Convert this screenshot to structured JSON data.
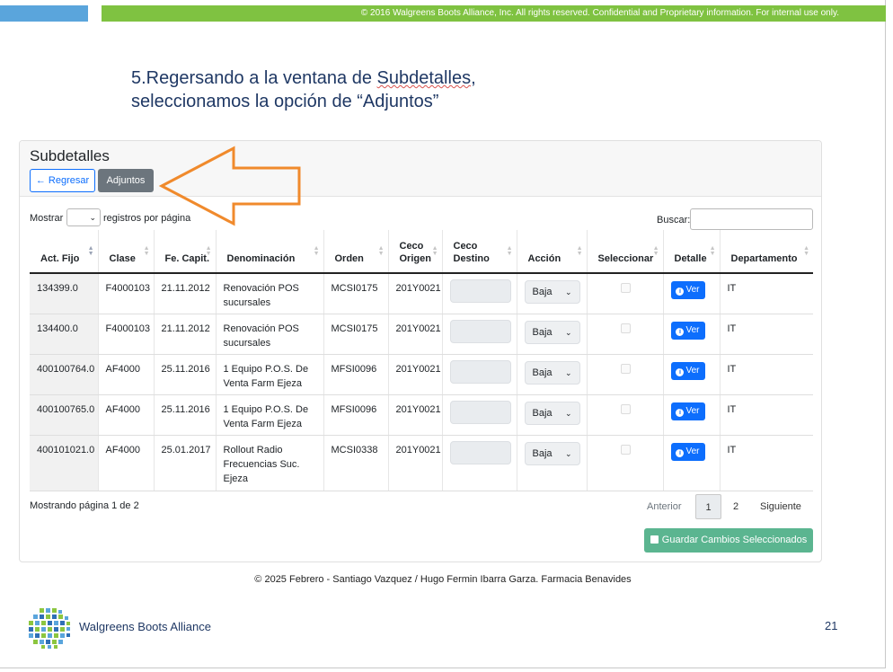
{
  "banner": {
    "copyright": "© 2016 Walgreens Boots Alliance, Inc. All rights reserved. Confidential and Proprietary information. For internal use only."
  },
  "instruction": {
    "line1_prefix": "5.Regersando a la ventana de ",
    "line1_word": "Subdetalles",
    "line1_suffix": ",",
    "line2": "seleccionamos la opción de “Adjuntos”"
  },
  "card": {
    "title": "Subdetalles",
    "back_label": "Regresar",
    "attach_label": "Adjuntos",
    "show_label": "Mostrar",
    "per_page_label": "registros por página",
    "search_label": "Buscar:",
    "columns": [
      "Act. Fijo",
      "Clase",
      "Fe. Capit.",
      "Denominación",
      "Orden",
      "Ceco Origen",
      "Ceco Destino",
      "Acción",
      "Seleccionar",
      "Detalle",
      "Departamento"
    ],
    "rows": [
      {
        "act": "134399.0",
        "clase": "F4000103",
        "fecha": "21.11.2012",
        "denom": "Renovación POS sucursales",
        "orden": "MCSI0175",
        "ceco_origen": "201Y0021",
        "accion": "Baja",
        "detalle": "Ver",
        "depto": "IT"
      },
      {
        "act": "134400.0",
        "clase": "F4000103",
        "fecha": "21.11.2012",
        "denom": "Renovación POS sucursales",
        "orden": "MCSI0175",
        "ceco_origen": "201Y0021",
        "accion": "Baja",
        "detalle": "Ver",
        "depto": "IT"
      },
      {
        "act": "400100764.0",
        "clase": "AF4000",
        "fecha": "25.11.2016",
        "denom": "1 Equipo P.O.S. De Venta Farm Ejeza",
        "orden": "MFSI0096",
        "ceco_origen": "201Y0021",
        "accion": "Baja",
        "detalle": "Ver",
        "depto": "IT"
      },
      {
        "act": "400100765.0",
        "clase": "AF4000",
        "fecha": "25.11.2016",
        "denom": "1 Equipo P.O.S. De Venta Farm Ejeza",
        "orden": "MFSI0096",
        "ceco_origen": "201Y0021",
        "accion": "Baja",
        "detalle": "Ver",
        "depto": "IT"
      },
      {
        "act": "400101021.0",
        "clase": "AF4000",
        "fecha": "25.01.2017",
        "denom": "Rollout Radio Frecuencias Suc. Ejeza",
        "orden": "MCSI0338",
        "ceco_origen": "201Y0021",
        "accion": "Baja",
        "detalle": "Ver",
        "depto": "IT"
      }
    ],
    "info": "Mostrando página 1 de 2",
    "pager": {
      "prev": "Anterior",
      "page1": "1",
      "page2": "2",
      "next": "Siguiente"
    },
    "save_label": "Guardar Cambios Seleccionados"
  },
  "footer": {
    "credits": "© 2025 Febrero - Santiago Vazquez / Hugo Fermin Ibarra Garza. Farmacia Benavides",
    "logo_text": "Walgreens Boots Alliance",
    "page_number": "21"
  },
  "colors": {
    "accent_blue": "#0d6efd",
    "banner_green": "#7fc241",
    "banner_blue": "#5aa5dc",
    "arrow_orange": "#f08a2c",
    "save_green": "#5bb590"
  }
}
